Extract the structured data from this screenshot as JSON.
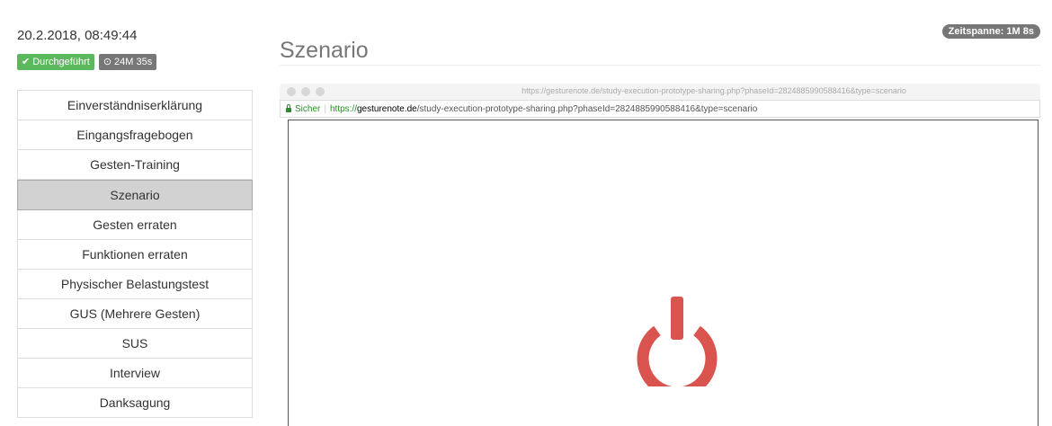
{
  "session": {
    "date": "20.2.2018, 08:49:44",
    "status_label": "Durchgeführt",
    "duration_label": "24M 35s"
  },
  "nav": {
    "items": [
      {
        "label": "Einverständniserklärung",
        "active": false
      },
      {
        "label": "Eingangsfragebogen",
        "active": false
      },
      {
        "label": "Gesten-Training",
        "active": false
      },
      {
        "label": "Szenario",
        "active": true
      },
      {
        "label": "Gesten erraten",
        "active": false
      },
      {
        "label": "Funktionen erraten",
        "active": false
      },
      {
        "label": "Physischer Belastungstest",
        "active": false
      },
      {
        "label": "GUS (Mehrere Gesten)",
        "active": false
      },
      {
        "label": "SUS",
        "active": false
      },
      {
        "label": "Interview",
        "active": false
      },
      {
        "label": "Danksagung",
        "active": false
      }
    ]
  },
  "main": {
    "title": "Szenario",
    "timespan_label": "Zeitspanne: 1M 8s"
  },
  "browser": {
    "titlebar_url": "https://gesturenote.de/study-execution-prototype-sharing.php?phaseId=2824885990588416&type=scenario",
    "secure_label": "Sicher",
    "url_scheme": "https://",
    "url_host": "gesturenote.de",
    "url_rest": "/study-execution-prototype-sharing.php?phaseId=2824885990588416&type=scenario"
  },
  "colors": {
    "success": "#5cb85c",
    "badge_gray": "#777777",
    "power_icon": "#d9534f",
    "active_nav": "#d2d2d2"
  },
  "icons": {
    "status": "check-icon",
    "duration": "clock-icon",
    "content": "power-icon"
  }
}
